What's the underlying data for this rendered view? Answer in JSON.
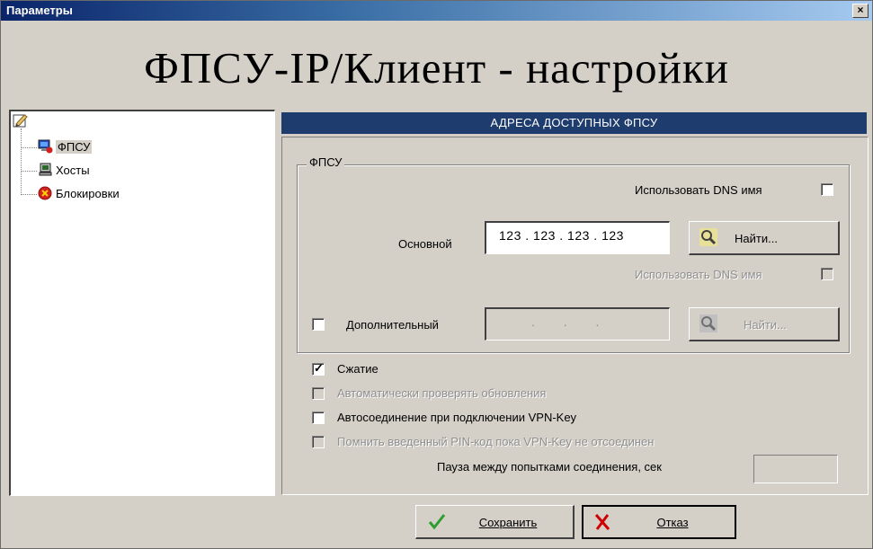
{
  "window": {
    "title": "Параметры",
    "close_glyph": "×"
  },
  "header": {
    "title": "ФПСУ-IP/Клиент - настройки"
  },
  "tree": {
    "items": [
      {
        "label": "ФПСУ",
        "icon": "computer-shield-icon",
        "selected": true
      },
      {
        "label": "Хосты",
        "icon": "computer-icon"
      },
      {
        "label": "Блокировки",
        "icon": "block-icon"
      }
    ]
  },
  "panel": {
    "heading": "АДРЕСА ДОСТУПНЫХ ФПСУ",
    "group_label": "ФПСУ",
    "use_dns_label": "Использовать DNS имя",
    "primary": {
      "label": "Основной",
      "ip": "123 . 123 . 123 . 123",
      "use_dns_label": "Использовать DNS имя",
      "find_label": "Найти..."
    },
    "secondary": {
      "label": "Дополнительный",
      "ip": " .  .  . ",
      "find_label": "Найти..."
    },
    "options": [
      {
        "label": "Сжатие",
        "checked": true,
        "enabled": true
      },
      {
        "label": "Автоматически проверять обновления",
        "checked": false,
        "enabled": false
      },
      {
        "label": "Автосоединение при подключении VPN-Key",
        "checked": false,
        "enabled": true
      },
      {
        "label": "Помнить введенный PIN-код пока VPN-Key не отсоединен",
        "checked": false,
        "enabled": false
      }
    ],
    "pause_label": "Пауза между попытками соединения, сек",
    "pause_value": ""
  },
  "footer": {
    "save_label": "Сохранить",
    "cancel_label": "Отказ"
  },
  "colors": {
    "panel_heading_bg": "#1e3c6e",
    "title_gradient_start": "#0a246a",
    "save_check": "#2e9e2e",
    "cancel_x": "#d00000"
  }
}
